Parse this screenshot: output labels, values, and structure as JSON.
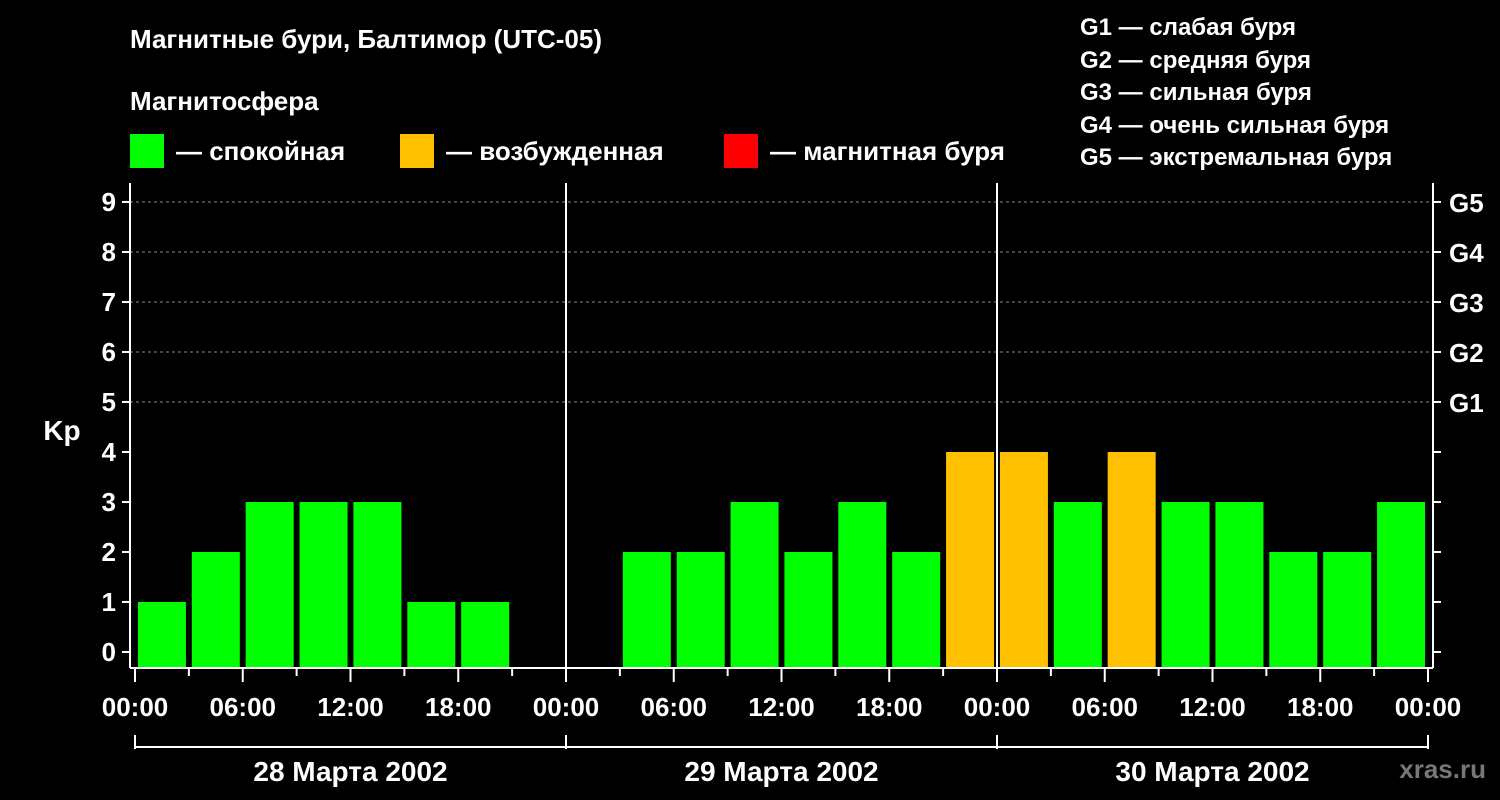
{
  "title": "Магнитные бури, Балтимор (UTC-05)",
  "subtitle": "Магнитосфера",
  "legend": [
    {
      "label": "— спокойная",
      "color": "#00ff00"
    },
    {
      "label": "— возбужденная",
      "color": "#ffc000"
    },
    {
      "label": "— магнитная буря",
      "color": "#ff0000"
    }
  ],
  "storm_scale": [
    "G1 — слабая буря",
    "G2 — средняя буря",
    "G3 — сильная буря",
    "G4 — очень сильная буря",
    "G5 — экстремальная буря"
  ],
  "watermark": "xras.ru",
  "chart_data": {
    "type": "bar",
    "ylabel": "Kp",
    "ylim": [
      0,
      9
    ],
    "yticks": [
      0,
      1,
      2,
      3,
      4,
      5,
      6,
      7,
      8,
      9
    ],
    "right_axis_labels": [
      {
        "kp": 5,
        "label": "G1"
      },
      {
        "kp": 6,
        "label": "G2"
      },
      {
        "kp": 7,
        "label": "G3"
      },
      {
        "kp": 8,
        "label": "G4"
      },
      {
        "kp": 9,
        "label": "G5"
      }
    ],
    "xticks": [
      "00:00",
      "06:00",
      "12:00",
      "18:00",
      "00:00",
      "06:00",
      "12:00",
      "18:00",
      "00:00",
      "06:00",
      "12:00",
      "18:00",
      "00:00"
    ],
    "days": [
      "28 Марта 2002",
      "29 Марта 2002",
      "30 Марта 2002"
    ],
    "bar_hours": [
      1.5,
      4.5,
      7.5,
      10.5,
      13.5,
      16.5,
      19.5,
      22.5,
      25.5,
      28.5,
      31.5,
      34.5,
      37.5,
      40.5,
      43.5,
      46.5,
      49.5,
      52.5,
      55.5,
      58.5,
      61.5,
      64.5,
      67.5,
      70.5
    ],
    "values": [
      1,
      2,
      3,
      3,
      3,
      1,
      1,
      0,
      0,
      2,
      2,
      3,
      2,
      3,
      2,
      4,
      4,
      3,
      4,
      3,
      3,
      2,
      2,
      3
    ],
    "colors": {
      "quiet": "#00ff00",
      "active": "#ffc000",
      "storm": "#ff0000"
    },
    "gridlines": [
      5,
      6,
      7,
      8,
      9
    ]
  }
}
